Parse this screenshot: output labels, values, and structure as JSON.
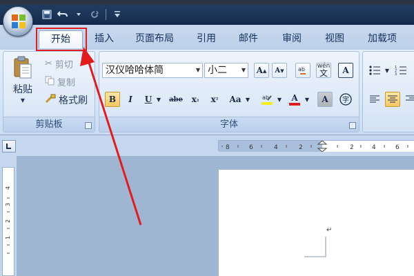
{
  "window": {
    "quick_access": [
      "save-icon",
      "undo-icon",
      "redo-icon",
      "customize-icon"
    ]
  },
  "tabs": [
    {
      "label": "开始",
      "active": true
    },
    {
      "label": "插入"
    },
    {
      "label": "页面布局"
    },
    {
      "label": "引用"
    },
    {
      "label": "邮件"
    },
    {
      "label": "审阅"
    },
    {
      "label": "视图"
    },
    {
      "label": "加载项"
    }
  ],
  "clipboard": {
    "paste_label": "粘贴",
    "cut_label": "剪切",
    "copy_label": "复制",
    "format_painter_label": "格式刷",
    "group_label": "剪贴板"
  },
  "font": {
    "font_name": "汉仪哈哈体简",
    "font_size": "小二",
    "group_label": "字体",
    "buttons": [
      "B",
      "I",
      "U",
      "abe",
      "x₂",
      "x²",
      "Aa",
      "A",
      "A"
    ]
  },
  "ruler": {
    "labels": [
      "8",
      "6",
      "4",
      "2",
      "2",
      "4",
      "6"
    ]
  },
  "colors": {
    "accent_red": "#e21c1c",
    "ribbon_blue": "#d7e6f8",
    "tab_text": "#15315c"
  }
}
